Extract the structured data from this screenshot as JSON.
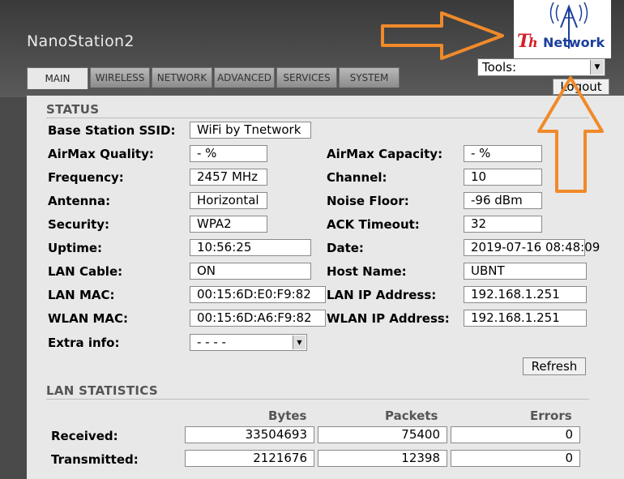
{
  "app_title": "NanoStation2",
  "tabs": [
    "MAIN",
    "WIRELESS",
    "NETWORK",
    "ADVANCED",
    "SERVICES",
    "SYSTEM"
  ],
  "logo": {
    "t": "T",
    "h": "h",
    "network": "Network"
  },
  "tools": {
    "selected": "Tools:"
  },
  "logout_label": "Logout",
  "status": {
    "title": "STATUS",
    "ssid": {
      "label": "Base Station SSID:",
      "value": "WiFi by Tnetwork"
    },
    "left": [
      {
        "label": "AirMax Quality:",
        "value": "- %"
      },
      {
        "label": "Frequency:",
        "value": "2457 MHz"
      },
      {
        "label": "Antenna:",
        "value": "Horizontal"
      },
      {
        "label": "Security:",
        "value": "WPA2"
      },
      {
        "label": "Uptime:",
        "value": "10:56:25"
      },
      {
        "label": "LAN Cable:",
        "value": "ON"
      },
      {
        "label": "LAN MAC:",
        "value": "00:15:6D:E0:F9:82"
      },
      {
        "label": "WLAN MAC:",
        "value": "00:15:6D:A6:F9:82"
      }
    ],
    "right": [
      {
        "label": "AirMax Capacity:",
        "value": "- %"
      },
      {
        "label": "Channel:",
        "value": "10"
      },
      {
        "label": "Noise Floor:",
        "value": "-96 dBm"
      },
      {
        "label": "ACK Timeout:",
        "value": "32"
      },
      {
        "label": "Date:",
        "value": "2019-07-16 08:48:09"
      },
      {
        "label": "Host Name:",
        "value": "UBNT"
      },
      {
        "label": "LAN IP Address:",
        "value": "192.168.1.251"
      },
      {
        "label": "WLAN IP Address:",
        "value": "192.168.1.251"
      }
    ],
    "extra": {
      "label": "Extra info:",
      "value": "- - - -"
    }
  },
  "refresh_label": "Refresh",
  "lan_stats": {
    "title": "LAN STATISTICS",
    "columns": [
      "Bytes",
      "Packets",
      "Errors"
    ],
    "rows": [
      {
        "label": "Received:",
        "bytes": "33504693",
        "packets": "75400",
        "errors": "0"
      },
      {
        "label": "Transmitted:",
        "bytes": "2121676",
        "packets": "12398",
        "errors": "0"
      }
    ]
  },
  "colors": {
    "accent_arrow": "#f08a2a",
    "logo_red": "#d4202a",
    "logo_blue": "#1c3f9c"
  }
}
